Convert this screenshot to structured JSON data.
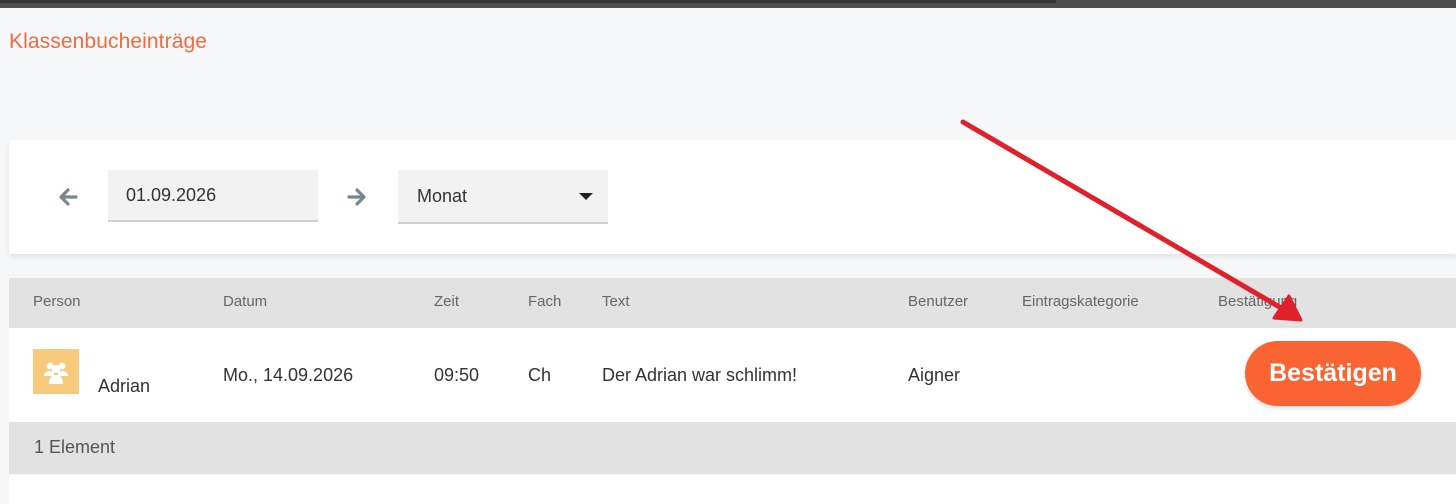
{
  "page": {
    "title": "Klassenbucheinträge"
  },
  "filter": {
    "date_value": "01.09.2026",
    "period_selected": "Monat",
    "prev_icon": "arrow-left-icon",
    "next_icon": "arrow-right-icon"
  },
  "table": {
    "columns": [
      "Person",
      "Datum",
      "Zeit",
      "Fach",
      "Text",
      "Benutzer",
      "Eintragskategorie",
      "Bestätigung"
    ],
    "rows": [
      {
        "avatar_icon": "group-icon",
        "person": "Adrian",
        "datum": "Mo., 14.09.2026",
        "zeit": "09:50",
        "fach": "Ch",
        "text": "Der Adrian war schlimm!",
        "benutzer": "Aigner",
        "eintragskategorie": "",
        "bestaetigung_button": "Bestätigen"
      }
    ],
    "footer_count": "1 Element"
  },
  "colors": {
    "accent": "#f26a3d",
    "button": "#f96432",
    "annotation_arrow": "#e0202a",
    "avatar_bg": "#f6c97b"
  }
}
